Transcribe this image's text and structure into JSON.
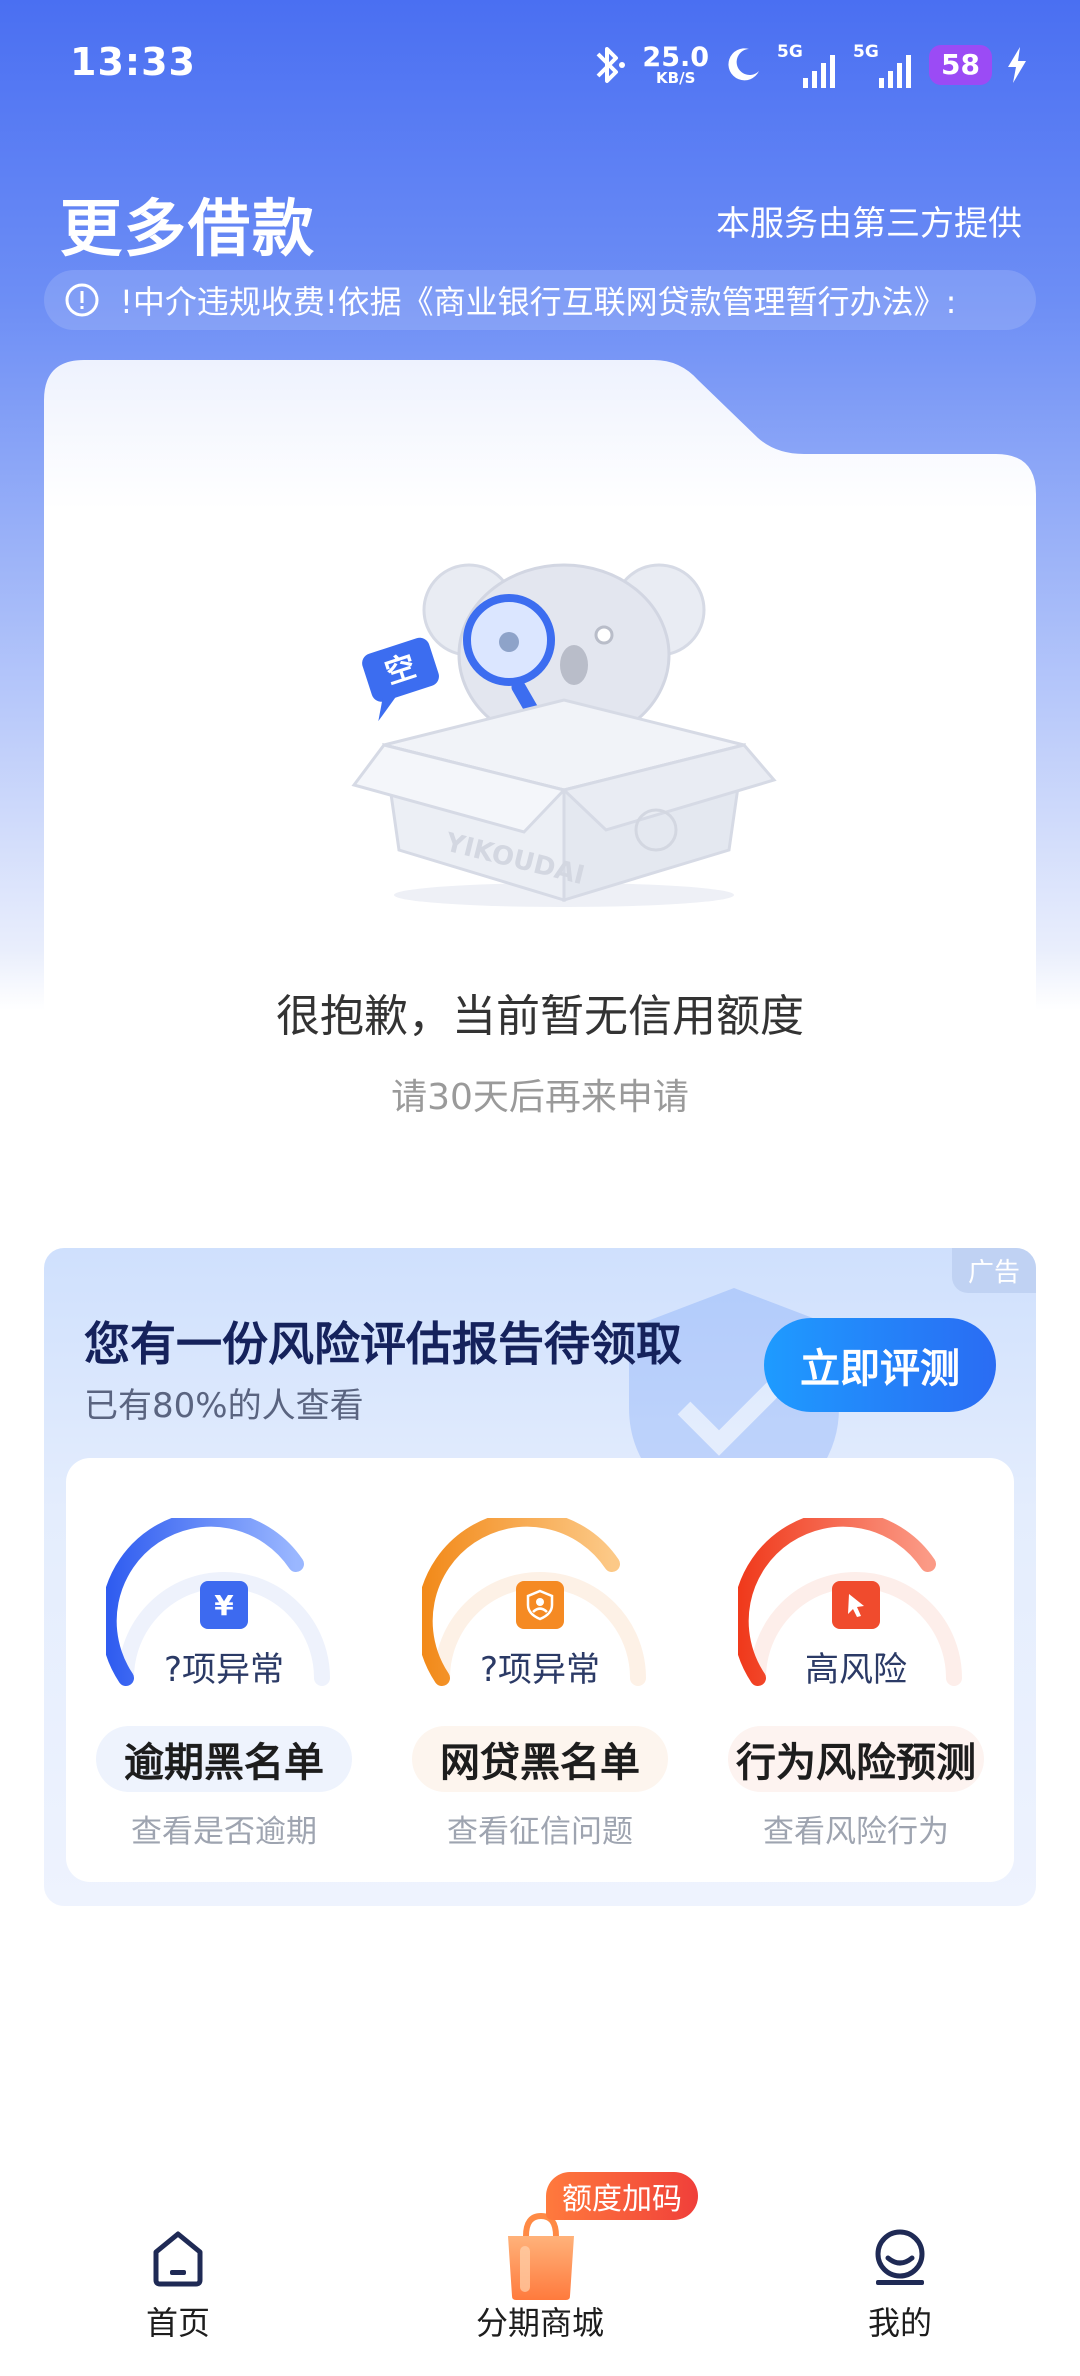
{
  "status_bar": {
    "time": "13:33",
    "net_speed_value": "25.0",
    "net_speed_unit": "KB/S",
    "signal_1": "5G",
    "signal_2": "5G",
    "battery": "58"
  },
  "header": {
    "title": "更多借款",
    "provider_note": "本服务由第三方提供"
  },
  "notice": {
    "icon": "info-icon",
    "text": "!中介违规收费!依据《商业银行互联网贷款管理暂行办法》:"
  },
  "empty_state": {
    "title": "很抱歉，当前暂无信用额度",
    "subtitle": "请30天后再来申请",
    "illustration": {
      "bubble_text": "空",
      "box_text": "YIKOUDAI"
    }
  },
  "risk_card": {
    "ad_tag": "广告",
    "title": "您有一份风险评估报告待领取",
    "subtitle": "已有80%的人查看",
    "button_label": "立即评测",
    "items": [
      {
        "gauge_text": "?项异常",
        "name": "逾期黑名单",
        "desc": "查看是否逾期",
        "icon": "yen-icon",
        "icon_glyph": "¥",
        "color": "#3d6af0"
      },
      {
        "gauge_text": "?项异常",
        "name": "网贷黑名单",
        "desc": "查看征信问题",
        "icon": "user-shield-icon",
        "icon_glyph": "",
        "color": "#f58a23"
      },
      {
        "gauge_text": "高风险",
        "name": "行为风险预测",
        "desc": "查看风险行为",
        "icon": "cursor-icon",
        "icon_glyph": "",
        "color": "#f04b2d"
      }
    ]
  },
  "bottom_nav": {
    "items": [
      {
        "label": "首页",
        "icon": "home-icon"
      },
      {
        "label": "分期商城",
        "icon": "shopping-bag-icon"
      },
      {
        "label": "我的",
        "icon": "profile-icon"
      }
    ],
    "badge": "额度加码"
  }
}
